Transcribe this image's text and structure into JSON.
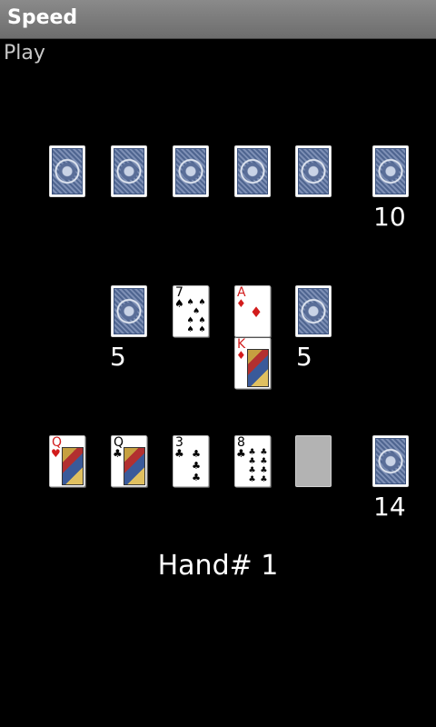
{
  "app": {
    "title": "Speed"
  },
  "menu": {
    "play_label": "Play"
  },
  "counts": {
    "opponent_stock": "10",
    "left_replacement": "5",
    "right_replacement": "5",
    "player_stock": "14"
  },
  "cards": {
    "center_left_pile": {
      "rank": "7",
      "suit": "♠"
    },
    "center_right_pile_top": {
      "rank": "A",
      "suit": "♦"
    },
    "center_right_pile_under": {
      "rank": "K",
      "suit": "♦"
    },
    "hand_1": {
      "rank": "Q",
      "suit": "♥"
    },
    "hand_2": {
      "rank": "Q",
      "suit": "♣"
    },
    "hand_3": {
      "rank": "3",
      "suit": "♣"
    },
    "hand_4": {
      "rank": "8",
      "suit": "♣"
    }
  },
  "hand": {
    "label": "Hand#",
    "number": "1"
  },
  "colors": {
    "background": "#000000",
    "titlebar": "#7a7a7a",
    "card_back": "#5a6e98",
    "red_suit": "#d21c1c"
  }
}
